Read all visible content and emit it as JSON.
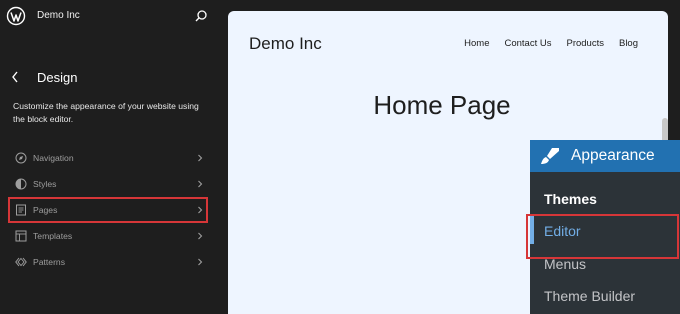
{
  "sidebar": {
    "site_name": "Demo Inc",
    "title": "Design",
    "description": "Customize the appearance of your website using the block editor.",
    "items": [
      {
        "label": "Navigation",
        "icon": "navigation-icon"
      },
      {
        "label": "Styles",
        "icon": "styles-icon"
      },
      {
        "label": "Pages",
        "icon": "pages-icon",
        "highlighted": true
      },
      {
        "label": "Templates",
        "icon": "templates-icon"
      },
      {
        "label": "Patterns",
        "icon": "patterns-icon"
      }
    ]
  },
  "preview": {
    "site_title": "Demo Inc",
    "nav": [
      "Home",
      "Contact Us",
      "Products",
      "Blog"
    ],
    "page_title": "Home Page"
  },
  "admin_menu": {
    "header": "Appearance",
    "items": [
      "Themes",
      "Editor",
      "Menus",
      "Theme Builder"
    ],
    "active_item": "Editor"
  },
  "colors": {
    "highlight": "#d63638",
    "admin_blue": "#2271b1",
    "admin_active": "#72aee6",
    "preview_bg": "#eef5ff"
  }
}
